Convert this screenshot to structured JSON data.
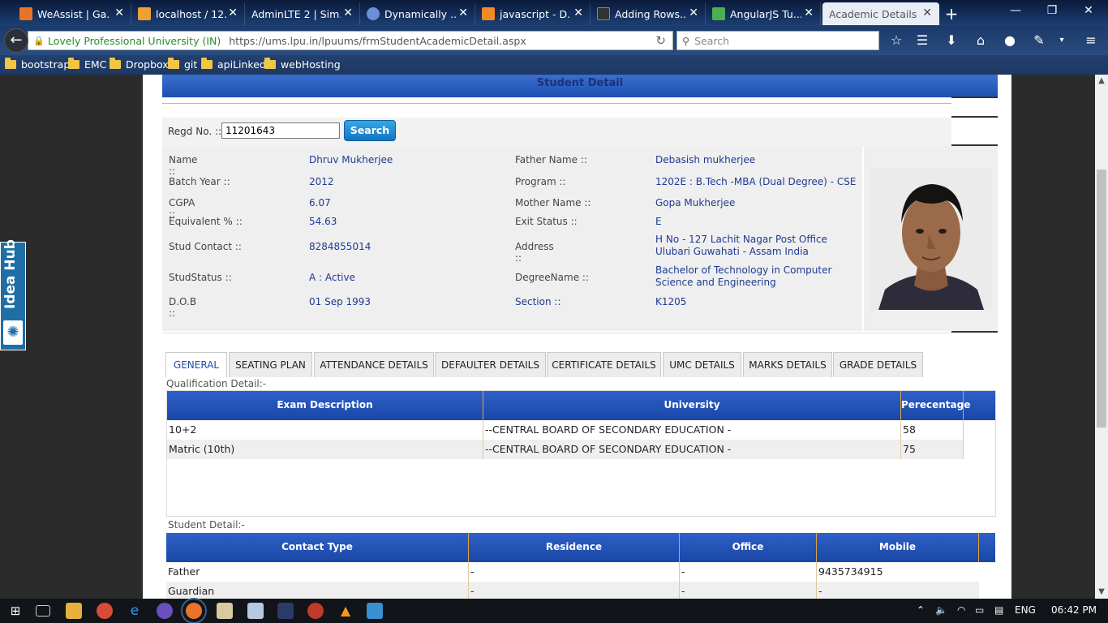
{
  "browser": {
    "tabs": [
      {
        "label": "WeAssist | Ga...",
        "color": "#e8742a"
      },
      {
        "label": "localhost / 12...",
        "color": "#f0a030"
      },
      {
        "label": "AdminLTE 2 | Sim...",
        "color": "#ffffff"
      },
      {
        "label": "Dynamically ...",
        "color": "#6b8fd8"
      },
      {
        "label": "javascript - D...",
        "color": "#f08a24"
      },
      {
        "label": "Adding Rows...",
        "color": "#333333"
      },
      {
        "label": "AngularJS Tu...",
        "color": "#4caf50"
      },
      {
        "label": "Academic Details",
        "color": "#e9eef6"
      }
    ],
    "site_identity": "Lovely Professional University (IN)",
    "url": "https://ums.lpu.in/lpuums/frmStudentAcademicDetail.aspx",
    "search_placeholder": "Search",
    "bookmarks": [
      "bootstrap",
      "EMC",
      "Dropbox",
      "git",
      "apiLinked",
      "webHosting"
    ]
  },
  "sidebar_widget": {
    "label": "Idea Hub"
  },
  "page": {
    "header_title": "Student Detail",
    "search": {
      "label": "Regd No. ::",
      "value": "11201643",
      "button": "Search"
    },
    "student": {
      "left": [
        {
          "label": "Name ::",
          "value": "Dhruv Mukherjee"
        },
        {
          "label": "Batch Year ::",
          "value": "2012"
        },
        {
          "label": "CGPA ::",
          "value": "6.07"
        },
        {
          "label": "Equivalent % ::",
          "value": "54.63"
        },
        {
          "label": "Stud Contact ::",
          "value": "8284855014"
        },
        {
          "label": "StudStatus ::",
          "value": "A : Active"
        },
        {
          "label": "D.O.B ::",
          "value": "01 Sep 1993"
        }
      ],
      "right": [
        {
          "label": "Father Name ::",
          "value": "Debasish mukherjee"
        },
        {
          "label": "Program ::",
          "value": "1202E : B.Tech -MBA (Dual Degree) - CSE"
        },
        {
          "label": "Mother Name ::",
          "value": "Gopa Mukherjee"
        },
        {
          "label": "Exit Status ::",
          "value": "E"
        },
        {
          "label": "Address ::",
          "value": "H No - 127 Lachit Nagar Post Office",
          "value2": "Ulubari Guwahati - Assam India"
        },
        {
          "label": "DegreeName ::",
          "value": "Bachelor of Technology in Computer",
          "value2": "Science and Engineering"
        },
        {
          "label": "Section ::",
          "value": "K1205"
        }
      ]
    },
    "tabs": [
      "GENERAL",
      "SEATING PLAN",
      "ATTENDANCE DETAILS",
      "DEFAULTER DETAILS",
      "CERTIFICATE DETAILS",
      "UMC DETAILS",
      "MARKS DETAILS",
      "GRADE DETAILS"
    ],
    "qualification": {
      "title": "Qualification Detail:-",
      "headers": [
        "Exam Description",
        "University",
        "Perecentage"
      ],
      "rows": [
        [
          "10+2",
          "--CENTRAL BOARD OF SECONDARY EDUCATION -",
          "58"
        ],
        [
          "Matric (10th)",
          "--CENTRAL BOARD OF SECONDARY EDUCATION -",
          "75"
        ]
      ]
    },
    "contacts": {
      "title": "Student Detail:-",
      "headers": [
        "Contact Type",
        "Residence",
        "Office",
        "Mobile"
      ],
      "rows": [
        [
          "Father",
          "-",
          "-",
          "9435734915"
        ],
        [
          "Guardian",
          "-",
          "-",
          "-"
        ]
      ]
    }
  },
  "taskbar": {
    "language": "ENG",
    "time": "06:42 PM"
  }
}
